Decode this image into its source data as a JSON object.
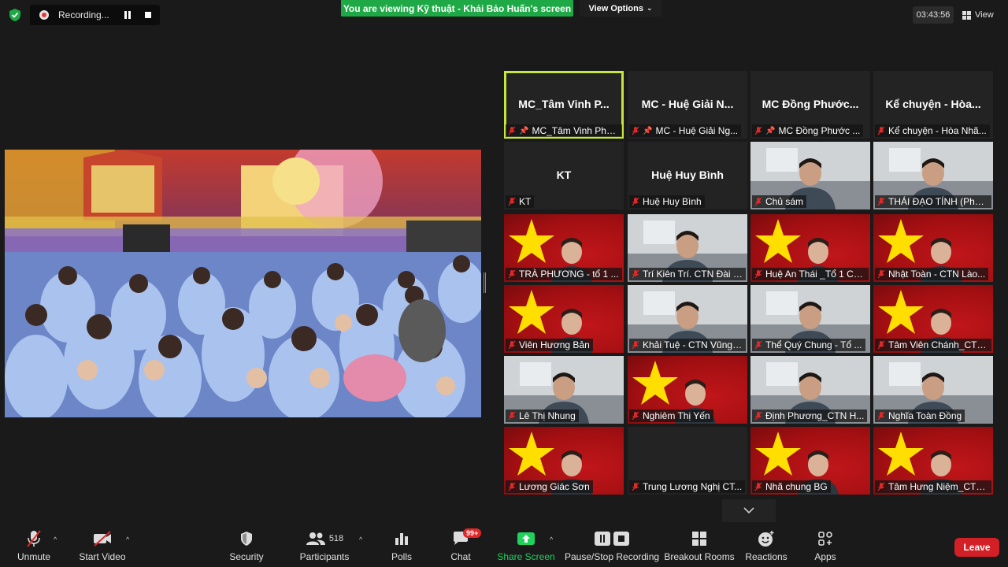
{
  "recording": {
    "label": "Recording..."
  },
  "banner": {
    "viewing": "You are viewing Kỹ thuật - Khải Bảo Huấn's screen",
    "options": "View Options"
  },
  "clock": {
    "time": "03:43:56",
    "view_label": "View"
  },
  "colors": {
    "green": "#1ea946",
    "active_border": "#c5e63f",
    "leave": "#d32026",
    "flag_red": "#c0161a",
    "flag_star": "#ffde00"
  },
  "tiles": [
    {
      "title": "MC_Tâm Vinh P...",
      "label": "MC_Tâm Vinh Pho...",
      "pinned": true,
      "active": true
    },
    {
      "title": "MC - Huệ Giải N...",
      "label": "MC - Huệ Giải Ng...",
      "pinned": true
    },
    {
      "title": "MC Đồng Phước...",
      "label": "MC Đồng Phước ...",
      "pinned": true
    },
    {
      "title": "Kể chuyện - Hòa...",
      "label": "Kể chuyện - Hòa Nhã..."
    },
    {
      "title": "KT",
      "label": "KT"
    },
    {
      "title": "Huệ Huy Bình",
      "label": "Huệ Huy Bình"
    },
    {
      "label": "Chủ sám"
    },
    {
      "label": "THÁI ĐẠO TÍNH (Phật..."
    },
    {
      "label": "TRÀ PHƯƠNG - tổ 1 ..."
    },
    {
      "label": "Trí Kiên Trí. CTN Đài L..."
    },
    {
      "label": "Huệ An Thái _Tổ 1 CT..."
    },
    {
      "label": "Nhật Toàn - CTN Lào..."
    },
    {
      "label": "Viên Hương Bản"
    },
    {
      "label": "Khải Tuệ - CTN Vũng ..."
    },
    {
      "label": "Thể Quý Chung - Tổ ..."
    },
    {
      "label": "Tâm Viên Chánh_CTN..."
    },
    {
      "label": "Lê Thị Nhung"
    },
    {
      "label": "Nghiêm Thị Yến"
    },
    {
      "label": "Định Phương_CTN H..."
    },
    {
      "label": "Nghĩa Toàn Đồng"
    },
    {
      "label": "Lương Giác Sơn"
    },
    {
      "label": "Trung Lương Nghị CT..."
    },
    {
      "label": "Nhã chung BG"
    },
    {
      "label": "Tâm Hưng Niệm_CTN..."
    }
  ],
  "toolbar": {
    "unmute": "Unmute",
    "start_video": "Start Video",
    "security": "Security",
    "participants": "Participants",
    "participants_count": "518",
    "polls": "Polls",
    "chat": "Chat",
    "chat_badge": "99+",
    "share_screen": "Share Screen",
    "pause_stop": "Pause/Stop Recording",
    "breakout": "Breakout Rooms",
    "reactions": "Reactions",
    "apps": "Apps",
    "leave": "Leave"
  }
}
